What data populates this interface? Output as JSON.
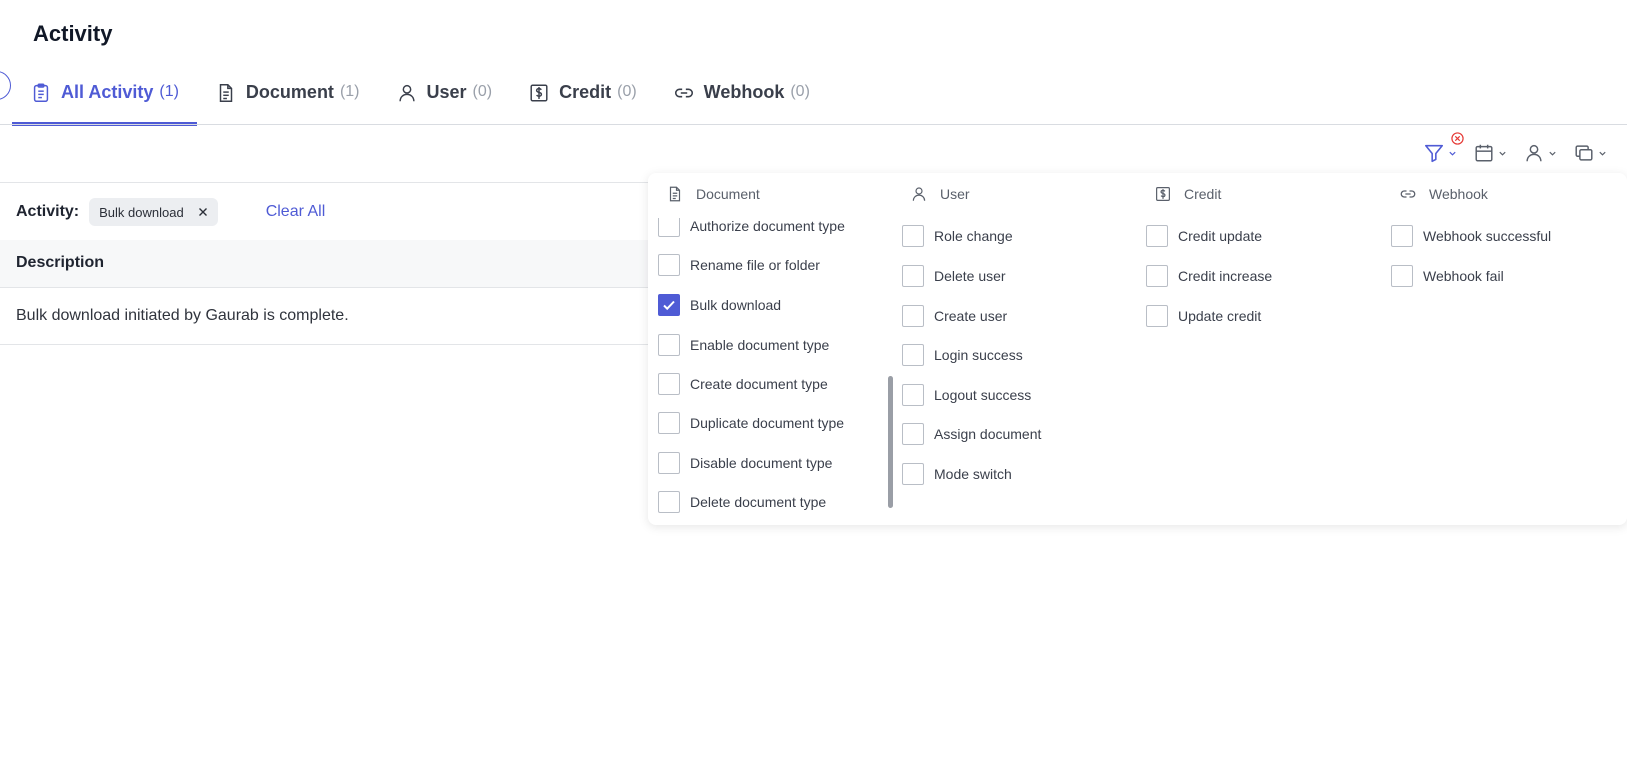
{
  "page": {
    "title": "Activity"
  },
  "tabs": [
    {
      "label": "All Activity",
      "count": "(1)",
      "icon": "clipboard-list-icon"
    },
    {
      "label": "Document",
      "count": "(1)",
      "icon": "document-icon"
    },
    {
      "label": "User",
      "count": "(0)",
      "icon": "user-icon"
    },
    {
      "label": "Credit",
      "count": "(0)",
      "icon": "dollar-icon"
    },
    {
      "label": "Webhook",
      "count": "(0)",
      "icon": "link-icon"
    }
  ],
  "toolbar": {
    "buttons": [
      "filter-icon",
      "calendar-icon",
      "user-icon",
      "copy-icon"
    ]
  },
  "filter": {
    "label": "Activity:",
    "chip": "Bulk download",
    "clear_all": "Clear All"
  },
  "table": {
    "header": "Description",
    "rows": [
      "Bulk download initiated by Gaurab is complete."
    ]
  },
  "panel": {
    "document": {
      "title": "Document",
      "options": [
        {
          "label": "Authorize document type",
          "checked": false
        },
        {
          "label": "Rename file or folder",
          "checked": false
        },
        {
          "label": "Bulk download",
          "checked": true
        },
        {
          "label": "Enable document type",
          "checked": false
        },
        {
          "label": "Create document type",
          "checked": false
        },
        {
          "label": "Duplicate document type",
          "checked": false
        },
        {
          "label": "Disable document type",
          "checked": false
        },
        {
          "label": "Delete document type",
          "checked": false
        }
      ]
    },
    "user": {
      "title": "User",
      "options": [
        {
          "label": "Role change",
          "checked": false
        },
        {
          "label": "Delete user",
          "checked": false
        },
        {
          "label": "Create user",
          "checked": false
        },
        {
          "label": "Login success",
          "checked": false
        },
        {
          "label": "Logout success",
          "checked": false
        },
        {
          "label": "Assign document",
          "checked": false
        },
        {
          "label": "Mode switch",
          "checked": false
        }
      ]
    },
    "credit": {
      "title": "Credit",
      "options": [
        {
          "label": "Credit update",
          "checked": false
        },
        {
          "label": "Credit increase",
          "checked": false
        },
        {
          "label": "Update credit",
          "checked": false
        }
      ]
    },
    "webhook": {
      "title": "Webhook",
      "options": [
        {
          "label": "Webhook successful",
          "checked": false
        },
        {
          "label": "Webhook fail",
          "checked": false
        }
      ]
    }
  },
  "colors": {
    "accent": "#4f5bd5",
    "badge": "#e53935"
  }
}
